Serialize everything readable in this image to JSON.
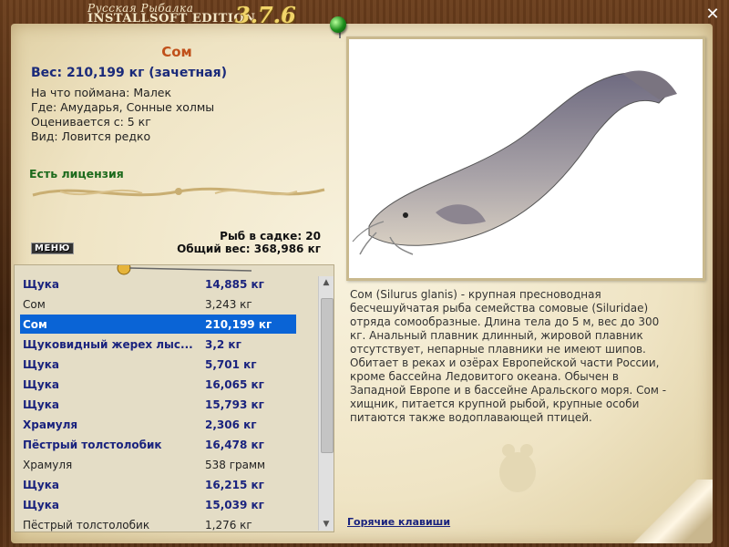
{
  "window": {
    "title_line1": "Русская Рыбалка",
    "title_line2": "INSTALLSOFT EDITION",
    "version": "3.7.6"
  },
  "fish": {
    "name": "Сом",
    "weight": "Вес: 210,199 кг (зачетная)",
    "caught_on": "На что поймана: Малек",
    "location": "Где: Амударья, Сонные холмы",
    "rated_from": "Оценивается с: 5 кг",
    "kind": "Вид: Ловится редко",
    "license": "Есть лицензия"
  },
  "keeper": {
    "count": "Рыб в садке: 20",
    "total_weight": "Общий вес: 368,986 кг"
  },
  "menu_label": "МЕНЮ",
  "catch_list": [
    {
      "name": "Щука",
      "weight": "14,885 кг",
      "style": "bold"
    },
    {
      "name": "Сом",
      "weight": "3,243 кг",
      "style": "plain"
    },
    {
      "name": "Сом",
      "weight": "210,199 кг",
      "style": "sel"
    },
    {
      "name": "Щуковидный жерех лыс...",
      "weight": "3,2 кг",
      "style": "bold"
    },
    {
      "name": "Щука",
      "weight": "5,701 кг",
      "style": "bold"
    },
    {
      "name": "Щука",
      "weight": "16,065 кг",
      "style": "bold"
    },
    {
      "name": "Щука",
      "weight": "15,793 кг",
      "style": "bold"
    },
    {
      "name": "Храмуля",
      "weight": "2,306 кг",
      "style": "bold"
    },
    {
      "name": "Пёстрый толстолобик",
      "weight": "16,478 кг",
      "style": "bold"
    },
    {
      "name": "Храмуля",
      "weight": "538 грамм",
      "style": "plain"
    },
    {
      "name": "Щука",
      "weight": "16,215 кг",
      "style": "bold"
    },
    {
      "name": "Щука",
      "weight": "15,039 кг",
      "style": "bold"
    },
    {
      "name": "Пёстрый толстолобик",
      "weight": "1,276 кг",
      "style": "plain"
    }
  ],
  "description": "Сом (Silurus glanis) - крупная пресноводная бесчешуйчатая рыба семейства сомовые (Siluridae) отряда сомообразные. Длина тела до 5 м, вес до 300 кг. Анальный плавник длинный, жировой плавник отсутствует, непарные плавники не имеют шипов. Обитает в реках и озёрах Европейской части России, кроме бассейна Ледовитого океана. Обычен в Западной Европе и в бассейне Аральского моря. Сом - хищник, питается крупной рыбой, крупные особи питаются также водоплавающей птицей.",
  "hotkeys_label": "Горячие клавиши",
  "colors": {
    "selection": "#0a64d6",
    "name_accent": "#c0501a",
    "list_text": "#1a237e",
    "license": "#1c6a1c"
  },
  "icons": [
    "close-icon",
    "green-ball-pin-icon",
    "catfish-picture",
    "fish-silhouette-icon"
  ]
}
